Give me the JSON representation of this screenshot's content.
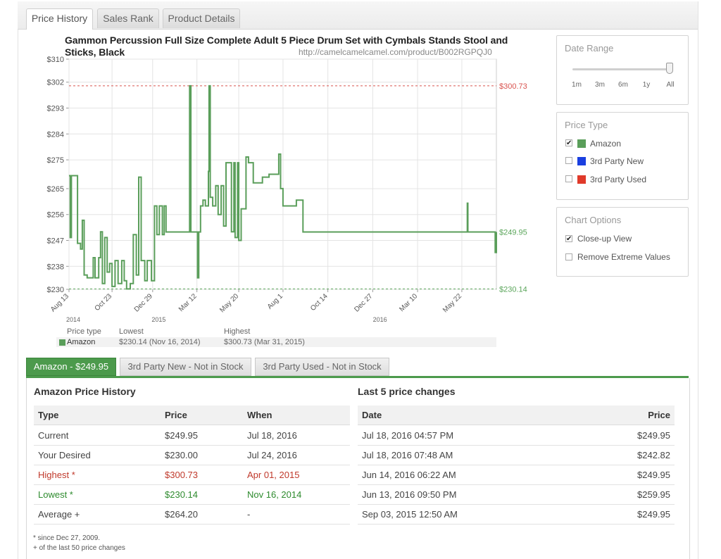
{
  "tabs": [
    "Price History",
    "Sales Rank",
    "Product Details"
  ],
  "chart": {
    "title": "Gammon Percussion Full Size Complete Adult 5 Piece Drum Set with Cymbals Stands Stool and Sticks, Black",
    "url": "http://camelcamelcamel.com/product/B002RGPQJ0"
  },
  "chart_data": {
    "type": "line",
    "title": "Gammon Percussion Full Size Complete Adult 5 Piece Drum Set with Cymbals Stands Stool and Sticks, Black",
    "y_tick_labels": [
      "$310",
      "$302",
      "$293",
      "$284",
      "$275",
      "$265",
      "$256",
      "$247",
      "$238",
      "$230"
    ],
    "y_ticks": [
      310,
      302,
      293,
      284,
      275,
      265,
      256,
      247,
      238,
      230
    ],
    "ylim": [
      230,
      310
    ],
    "x_tick_labels": [
      "Aug 13",
      "Oct 23",
      "Dec 29",
      "Mar 12",
      "May 20",
      "Aug 1",
      "Oct 14",
      "Dec 27",
      "Mar 10",
      "May 22"
    ],
    "x_tick_dates": [
      "2014-08-13",
      "2014-10-23",
      "2014-12-29",
      "2015-03-12",
      "2015-05-20",
      "2015-08-01",
      "2015-10-14",
      "2015-12-27",
      "2016-03-10",
      "2016-05-22"
    ],
    "x_start": "2014-08-13",
    "x_end": "2016-07-18",
    "year_labels": [
      {
        "label": "2014",
        "date": "2014-08-13"
      },
      {
        "label": "2015",
        "date": "2015-01-01"
      },
      {
        "label": "2016",
        "date": "2016-01-01"
      }
    ],
    "reference_lines": [
      {
        "label": "$300.73",
        "value": 300.73,
        "color": "#d9534f"
      },
      {
        "label": "$230.14",
        "value": 230.14,
        "color": "#5aa55a"
      }
    ],
    "current_label": {
      "label": "$249.95",
      "value": 249.95
    },
    "series": [
      {
        "name": "Amazon",
        "color": "#5a9e5a",
        "points": [
          [
            "2014-08-13",
            269.5
          ],
          [
            "2014-08-15",
            248
          ],
          [
            "2014-08-17",
            269.5
          ],
          [
            "2014-08-25",
            269.5
          ],
          [
            "2014-08-27",
            246
          ],
          [
            "2014-09-01",
            244
          ],
          [
            "2014-09-04",
            254
          ],
          [
            "2014-09-07",
            235
          ],
          [
            "2014-09-12",
            234
          ],
          [
            "2014-09-18",
            234
          ],
          [
            "2014-09-22",
            241
          ],
          [
            "2014-09-25",
            234
          ],
          [
            "2014-10-01",
            241
          ],
          [
            "2014-10-04",
            250
          ],
          [
            "2014-10-07",
            232
          ],
          [
            "2014-10-11",
            248
          ],
          [
            "2014-10-15",
            236
          ],
          [
            "2014-10-19",
            239
          ],
          [
            "2014-10-23",
            231
          ],
          [
            "2014-10-28",
            240
          ],
          [
            "2014-11-02",
            232
          ],
          [
            "2014-11-08",
            240
          ],
          [
            "2014-11-12",
            233
          ],
          [
            "2014-11-16",
            230.14
          ],
          [
            "2014-11-22",
            232
          ],
          [
            "2014-11-27",
            249
          ],
          [
            "2014-12-02",
            235
          ],
          [
            "2014-12-06",
            269
          ],
          [
            "2014-12-10",
            240
          ],
          [
            "2014-12-16",
            233
          ],
          [
            "2014-12-20",
            240
          ],
          [
            "2014-12-27",
            233
          ],
          [
            "2015-01-01",
            259
          ],
          [
            "2015-01-05",
            249
          ],
          [
            "2015-01-09",
            259
          ],
          [
            "2015-01-14",
            249
          ],
          [
            "2015-01-17",
            259
          ],
          [
            "2015-01-20",
            249.95
          ],
          [
            "2015-02-20",
            249.95
          ],
          [
            "2015-02-25",
            249.95
          ],
          [
            "2015-02-28",
            300.73
          ],
          [
            "2015-03-02",
            249.95
          ],
          [
            "2015-03-10",
            249.95
          ],
          [
            "2015-03-13",
            234
          ],
          [
            "2015-03-15",
            249.95
          ],
          [
            "2015-03-18",
            259
          ],
          [
            "2015-03-22",
            261
          ],
          [
            "2015-03-26",
            259
          ],
          [
            "2015-03-31",
            271
          ],
          [
            "2015-04-01",
            300.73
          ],
          [
            "2015-04-03",
            262
          ],
          [
            "2015-04-07",
            259
          ],
          [
            "2015-04-12",
            266
          ],
          [
            "2015-04-16",
            256
          ],
          [
            "2015-04-21",
            266
          ],
          [
            "2015-04-25",
            252
          ],
          [
            "2015-04-29",
            274
          ],
          [
            "2015-05-04",
            274
          ],
          [
            "2015-05-08",
            250
          ],
          [
            "2015-05-12",
            274
          ],
          [
            "2015-05-14",
            248
          ],
          [
            "2015-05-18",
            274
          ],
          [
            "2015-05-20",
            247
          ],
          [
            "2015-05-24",
            258
          ],
          [
            "2015-05-30",
            258
          ],
          [
            "2015-06-01",
            276
          ],
          [
            "2015-06-05",
            274
          ],
          [
            "2015-06-10",
            274
          ],
          [
            "2015-06-13",
            267
          ],
          [
            "2015-06-20",
            267
          ],
          [
            "2015-06-25",
            267
          ],
          [
            "2015-06-28",
            269
          ],
          [
            "2015-07-05",
            269
          ],
          [
            "2015-07-09",
            270
          ],
          [
            "2015-07-14",
            270
          ],
          [
            "2015-07-20",
            270
          ],
          [
            "2015-07-25",
            277
          ],
          [
            "2015-07-28",
            265
          ],
          [
            "2015-08-01",
            259
          ],
          [
            "2015-08-20",
            259
          ],
          [
            "2015-08-23",
            261
          ],
          [
            "2015-09-03",
            261
          ],
          [
            "2015-09-03",
            249.95
          ],
          [
            "2016-05-28",
            249.95
          ],
          [
            "2016-05-31",
            259.95
          ],
          [
            "2016-06-01",
            249.95
          ],
          [
            "2016-07-14",
            249.95
          ],
          [
            "2016-07-16",
            242.82
          ],
          [
            "2016-07-18",
            249.95
          ]
        ]
      }
    ]
  },
  "legend": {
    "headers": [
      "Price type",
      "Lowest",
      "Highest"
    ],
    "rows": [
      {
        "name": "Amazon",
        "lowest": "$230.14 (Nov 16, 2014)",
        "highest": "$300.73 (Mar 31, 2015)"
      }
    ]
  },
  "date_range": {
    "title": "Date Range",
    "options": [
      "1m",
      "3m",
      "6m",
      "1y",
      "All"
    ],
    "selected": "All"
  },
  "price_type": {
    "title": "Price Type",
    "items": [
      {
        "label": "Amazon",
        "checked": true,
        "color": "#5a9e5a"
      },
      {
        "label": "3rd Party New",
        "checked": false,
        "color": "#1a3fe0"
      },
      {
        "label": "3rd Party Used",
        "checked": false,
        "color": "#e03a2a"
      }
    ]
  },
  "chart_options": {
    "title": "Chart Options",
    "items": [
      {
        "label": "Close-up View",
        "checked": true
      },
      {
        "label": "Remove Extreme Values",
        "checked": false
      }
    ]
  },
  "bottom_tabs": [
    "Amazon - $249.95",
    "3rd Party New - Not in Stock",
    "3rd Party Used - Not in Stock"
  ],
  "history": {
    "title": "Amazon Price History",
    "headers": [
      "Type",
      "Price",
      "When"
    ],
    "rows": [
      {
        "type": "Current",
        "price": "$249.95",
        "when": "Jul 18, 2016"
      },
      {
        "type": "Your Desired",
        "price": "$230.00",
        "when": "Jul 24, 2016"
      },
      {
        "type": "Highest *",
        "price": "$300.73",
        "when": "Apr 01, 2015"
      },
      {
        "type": "Lowest *",
        "price": "$230.14",
        "when": "Nov 16, 2014"
      },
      {
        "type": "Average +",
        "price": "$264.20",
        "when": "-"
      }
    ],
    "notes": [
      "* since Dec 27, 2009.",
      "+ of the last 50 price changes"
    ]
  },
  "changes": {
    "title": "Last 5 price changes",
    "headers": [
      "Date",
      "Price"
    ],
    "rows": [
      {
        "date": "Jul 18, 2016 04:57 PM",
        "price": "$249.95"
      },
      {
        "date": "Jul 18, 2016 07:48 AM",
        "price": "$242.82"
      },
      {
        "date": "Jun 14, 2016 06:22 AM",
        "price": "$249.95"
      },
      {
        "date": "Jun 13, 2016 09:50 PM",
        "price": "$259.95"
      },
      {
        "date": "Sep 03, 2015 12:50 AM",
        "price": "$249.95"
      }
    ]
  }
}
